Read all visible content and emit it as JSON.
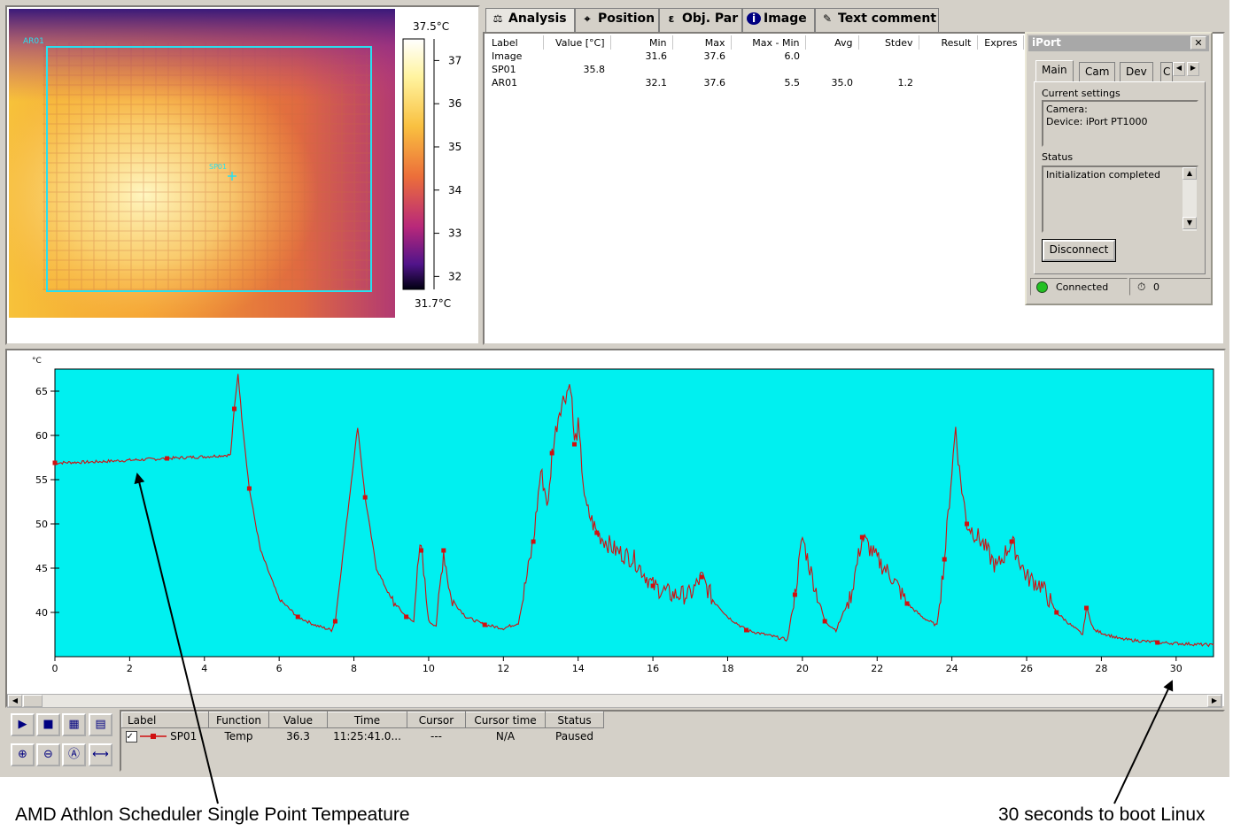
{
  "thermal": {
    "roi_label": "AR01",
    "spot_label": "SP01",
    "scale_max": "37.5°C",
    "scale_min": "31.7°C",
    "scale_ticks": [
      "37",
      "36",
      "35",
      "34",
      "33",
      "32"
    ]
  },
  "tabs": [
    {
      "label": "Analysis",
      "icon": "analysis-icon"
    },
    {
      "label": "Position",
      "icon": "position-icon"
    },
    {
      "label": "Obj. Par",
      "icon": "object-parameters-icon"
    },
    {
      "label": "Image",
      "icon": "info-icon"
    },
    {
      "label": "Text comment",
      "icon": "text-comment-icon"
    }
  ],
  "analysis": {
    "columns": [
      "Label",
      "Value [°C]",
      "Min",
      "Max",
      "Max - Min",
      "Avg",
      "Stdev",
      "Result",
      "Expres"
    ],
    "rows": [
      [
        "Image",
        "",
        "31.6",
        "37.6",
        "6.0",
        "",
        "",
        "",
        ""
      ],
      [
        "SP01",
        "35.8",
        "",
        "",
        "",
        "",
        "",
        "",
        ""
      ],
      [
        "AR01",
        "",
        "32.1",
        "37.6",
        "5.5",
        "35.0",
        "1.2",
        "",
        ""
      ]
    ]
  },
  "iport": {
    "title": "iPort",
    "close": "✕",
    "tabs": [
      "Main",
      "Cam",
      "Dev",
      "C"
    ],
    "current_settings_label": "Current settings",
    "settings_lines": [
      "Camera:",
      "Device: iPort PT1000"
    ],
    "status_label": "Status",
    "status_text": "Initialization completed",
    "disconnect_label": "Disconnect",
    "connection_status": "Connected",
    "connection_color": "#22c022",
    "counter": "0"
  },
  "chart_data": {
    "type": "line",
    "ylabel": "°C",
    "xlim": [
      0,
      31
    ],
    "ylim": [
      35,
      67.5
    ],
    "x_ticks": [
      0,
      2,
      4,
      6,
      8,
      10,
      12,
      14,
      16,
      18,
      20,
      22,
      24,
      26,
      28,
      30
    ],
    "y_ticks": [
      40,
      45,
      50,
      55,
      60,
      65
    ],
    "background": "#00f0f0",
    "series": [
      {
        "name": "SP01",
        "color": "#d01010",
        "points": [
          [
            0,
            56.9
          ],
          [
            1,
            57.0
          ],
          [
            2,
            57.2
          ],
          [
            3,
            57.4
          ],
          [
            4,
            57.6
          ],
          [
            4.7,
            57.8
          ],
          [
            4.8,
            63
          ],
          [
            4.9,
            67
          ],
          [
            5.0,
            62
          ],
          [
            5.2,
            54
          ],
          [
            5.5,
            47
          ],
          [
            6,
            41.5
          ],
          [
            6.5,
            39.5
          ],
          [
            7,
            38.5
          ],
          [
            7.4,
            38.0
          ],
          [
            7.5,
            39
          ],
          [
            7.8,
            50
          ],
          [
            8.1,
            61
          ],
          [
            8.3,
            53
          ],
          [
            8.6,
            45
          ],
          [
            9,
            41.5
          ],
          [
            9.4,
            39.5
          ],
          [
            9.6,
            38.9
          ],
          [
            9.7,
            46
          ],
          [
            9.8,
            47
          ],
          [
            10,
            39
          ],
          [
            10.2,
            38.5
          ],
          [
            10.4,
            47
          ],
          [
            10.6,
            41.5
          ],
          [
            11,
            39.5
          ],
          [
            11.5,
            38.6
          ],
          [
            12,
            38.2
          ],
          [
            12.4,
            38.8
          ],
          [
            12.8,
            48
          ],
          [
            13.0,
            56
          ],
          [
            13.2,
            52
          ],
          [
            13.3,
            58
          ],
          [
            13.5,
            63
          ],
          [
            13.8,
            66
          ],
          [
            13.9,
            59
          ],
          [
            14.0,
            61
          ],
          [
            14.2,
            52
          ],
          [
            14.5,
            49
          ],
          [
            15,
            47
          ],
          [
            15.5,
            46
          ],
          [
            16,
            43
          ],
          [
            16.5,
            42
          ],
          [
            17,
            42
          ],
          [
            17.3,
            44
          ],
          [
            17.6,
            41.5
          ],
          [
            18,
            39.5
          ],
          [
            18.5,
            38
          ],
          [
            19,
            37.5
          ],
          [
            19.6,
            36.9
          ],
          [
            19.8,
            42
          ],
          [
            20.0,
            48.5
          ],
          [
            20.2,
            45
          ],
          [
            20.6,
            39
          ],
          [
            20.9,
            38
          ],
          [
            21.3,
            42
          ],
          [
            21.6,
            48.5
          ],
          [
            22,
            46
          ],
          [
            22.4,
            44
          ],
          [
            22.8,
            41
          ],
          [
            23.2,
            39.5
          ],
          [
            23.6,
            38.5
          ],
          [
            23.8,
            46
          ],
          [
            24.1,
            61
          ],
          [
            24.2,
            56
          ],
          [
            24.4,
            50
          ],
          [
            24.8,
            48
          ],
          [
            25.2,
            45
          ],
          [
            25.6,
            48
          ],
          [
            26,
            44
          ],
          [
            26.4,
            43
          ],
          [
            26.8,
            40
          ],
          [
            27.2,
            38.5
          ],
          [
            27.5,
            37.5
          ],
          [
            27.6,
            40.5
          ],
          [
            27.8,
            38
          ],
          [
            28.5,
            37.0
          ],
          [
            29.5,
            36.6
          ],
          [
            30.5,
            36.4
          ],
          [
            31,
            36.3
          ]
        ]
      }
    ]
  },
  "toolbar": {
    "buttons": [
      {
        "name": "play-button",
        "glyph": "▶"
      },
      {
        "name": "stop-button",
        "glyph": "■"
      },
      {
        "name": "chart-settings-button",
        "glyph": "▦"
      },
      {
        "name": "chart-properties-button",
        "glyph": "▤"
      },
      {
        "name": "zoom-in-button",
        "glyph": "⊕"
      },
      {
        "name": "zoom-out-button",
        "glyph": "⊖"
      },
      {
        "name": "zoom-auto-button",
        "glyph": "Ⓐ"
      },
      {
        "name": "fit-width-button",
        "glyph": "⟷"
      }
    ]
  },
  "series_table": {
    "columns": [
      "Label",
      "Function",
      "Value",
      "Time",
      "Cursor",
      "Cursor time",
      "Status"
    ],
    "rows": [
      {
        "label": "SP01",
        "function": "Temp",
        "value": "36.3",
        "time": "11:25:41.0...",
        "cursor": "---",
        "cursor_time": "N/A",
        "status": "Paused"
      }
    ]
  },
  "annotations": {
    "left": "AMD Athlon Scheduler Single Point Tempeature",
    "right": "30 seconds to boot Linux"
  }
}
